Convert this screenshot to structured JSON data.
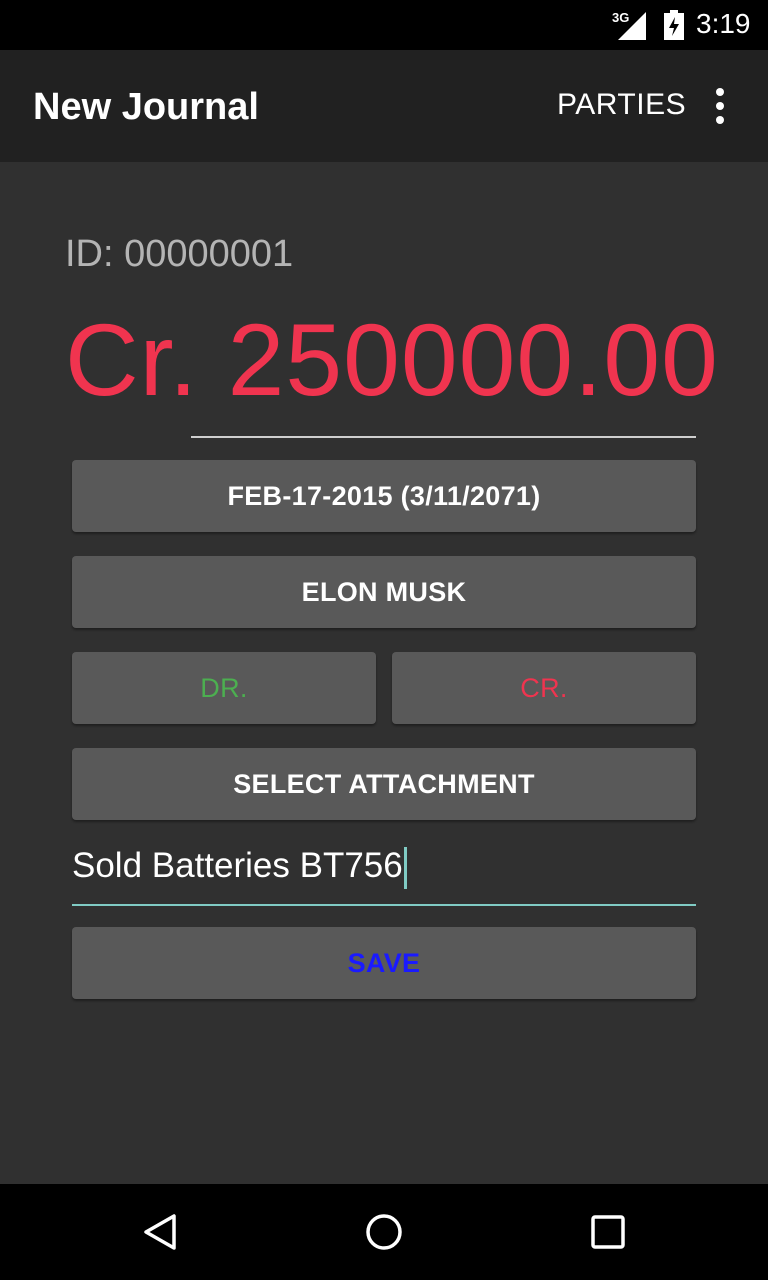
{
  "status_bar": {
    "network": "3G",
    "time": "3:19"
  },
  "app_bar": {
    "title": "New Journal",
    "action_label": "PARTIES"
  },
  "journal": {
    "id_label": "ID: 00000001",
    "amount_display": "Cr. 250000.00",
    "amount_color": "#f0344f"
  },
  "buttons": {
    "date_label": "FEB-17-2015 (3/11/2071)",
    "party_label": "ELON MUSK",
    "debit_label": "DR.",
    "credit_label": "CR.",
    "attachment_label": "SELECT ATTACHMENT",
    "save_label": "SAVE"
  },
  "description": {
    "value": "Sold Batteries BT756"
  },
  "colors": {
    "background": "#303030",
    "app_bar": "#212121",
    "button": "#595959",
    "debit": "#4caf50",
    "credit": "#f0344f",
    "save": "#1a1aff",
    "accent": "#80cbc4"
  },
  "icons": {
    "status": [
      "signal-icon",
      "battery-icon"
    ],
    "navigation": [
      "back-icon",
      "home-icon",
      "recent-apps-icon"
    ],
    "menu": "overflow-menu-icon"
  }
}
